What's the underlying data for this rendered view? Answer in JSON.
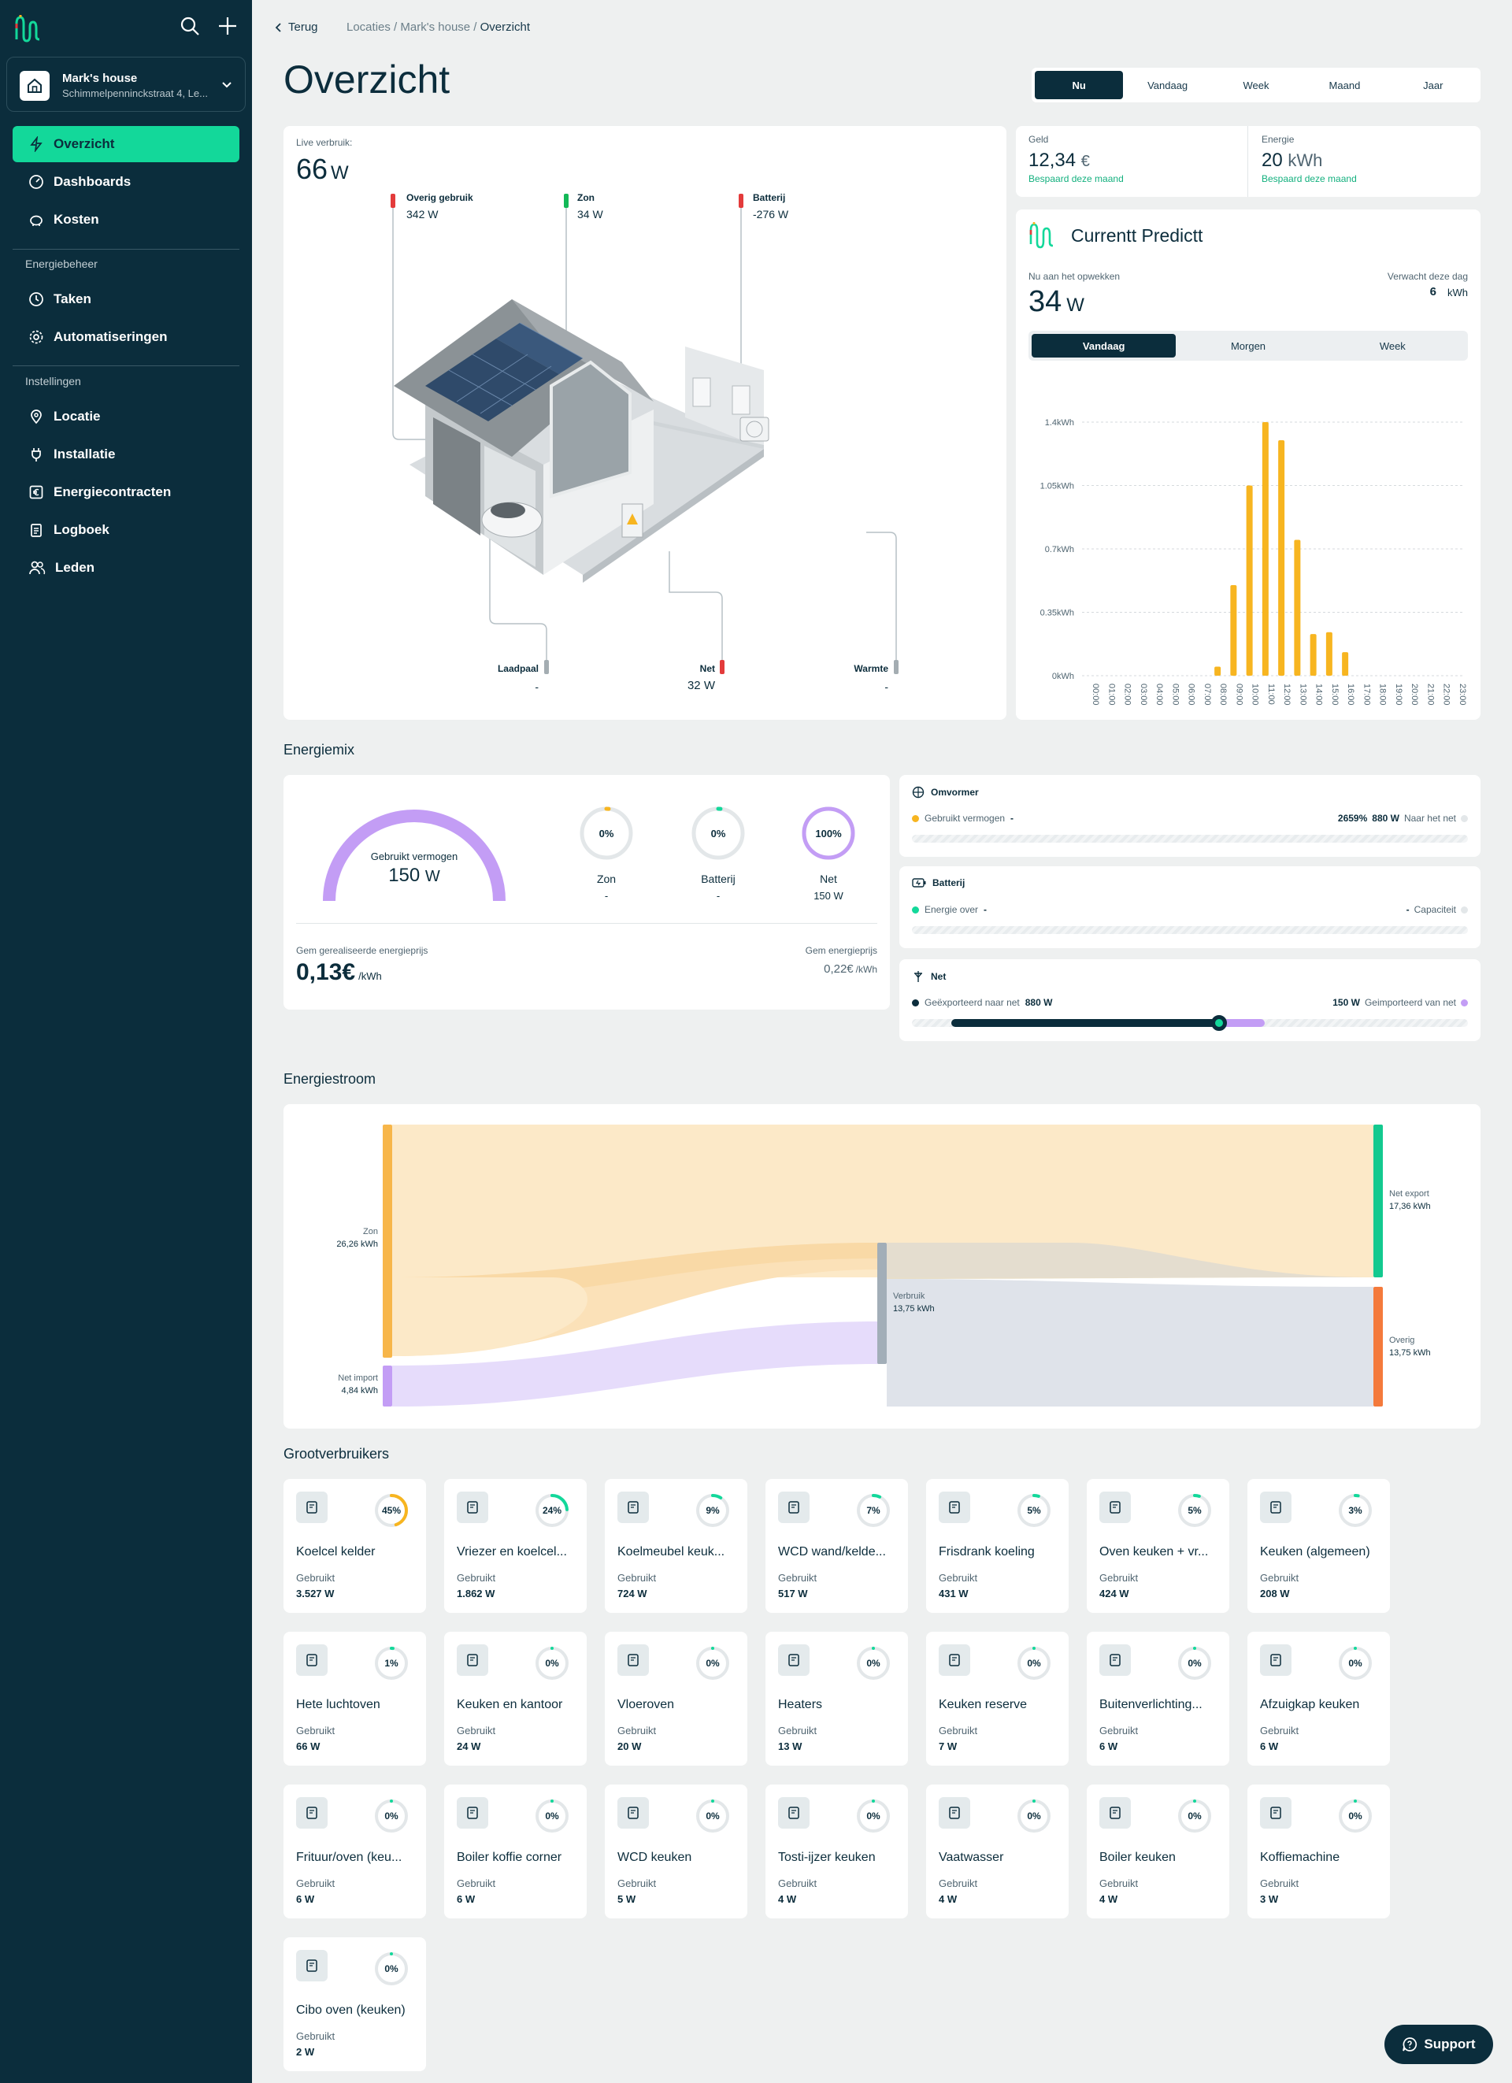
{
  "header": {
    "back": "Terug",
    "breadcrumb_a": "Locaties",
    "breadcrumb_b": "Mark's house",
    "breadcrumb_c": "Overzicht",
    "sep": "/",
    "title": "Overzicht",
    "time_tabs": [
      "Nu",
      "Vandaag",
      "Week",
      "Maand",
      "Jaar"
    ]
  },
  "sidebar": {
    "location_name": "Mark's house",
    "location_address": "Schimmelpenninckstraat 4, Le...",
    "nav_main": [
      "Overzicht",
      "Dashboards",
      "Kosten"
    ],
    "section_energy": "Energiebeheer",
    "nav_energy": [
      "Taken",
      "Automatiseringen"
    ],
    "section_settings": "Instellingen",
    "nav_settings": [
      "Locatie",
      "Installatie",
      "Energiecontracten",
      "Logboek",
      "Leden"
    ]
  },
  "live": {
    "label": "Live verbruik:",
    "value": "66",
    "unit": "W",
    "overig": {
      "label": "Overig gebruik",
      "value": "342 W"
    },
    "zon": {
      "label": "Zon",
      "value": "34 W"
    },
    "batterij": {
      "label": "Batterij",
      "value": "-276 W"
    },
    "laadpaal": {
      "label": "Laadpaal",
      "value": "-"
    },
    "net": {
      "label": "Net",
      "value": "32",
      "unit": "W"
    },
    "warmte": {
      "label": "Warmte",
      "value": "-"
    }
  },
  "summary": {
    "geld": {
      "label": "Geld",
      "value": "12,34",
      "unit": "€",
      "sub": "Bespaard deze maand"
    },
    "energie": {
      "label": "Energie",
      "value": "20",
      "unit": "kWh",
      "sub": "Bespaard deze maand"
    }
  },
  "predict": {
    "title": "Currentt Predictt",
    "now_label": "Nu aan het opwekken",
    "now_value": "34",
    "now_unit": "W",
    "exp_label": "Verwacht deze dag",
    "exp_value": "6",
    "exp_unit": "kWh",
    "tabs": [
      "Vandaag",
      "Morgen",
      "Week"
    ]
  },
  "chart_data": {
    "type": "bar",
    "categories": [
      "00:00",
      "01:00",
      "02:00",
      "03:00",
      "04:00",
      "05:00",
      "06:00",
      "07:00",
      "08:00",
      "09:00",
      "10:00",
      "11:00",
      "12:00",
      "13:00",
      "14:00",
      "15:00",
      "16:00",
      "17:00",
      "18:00",
      "19:00",
      "20:00",
      "21:00",
      "22:00",
      "23:00"
    ],
    "values": [
      0,
      0,
      0,
      0,
      0,
      0,
      0,
      0,
      0.05,
      0.5,
      1.05,
      1.4,
      1.3,
      0.75,
      0.23,
      0.24,
      0.13,
      0,
      0,
      0,
      0,
      0,
      0,
      0
    ],
    "yticks": [
      "0kWh",
      "0.35kWh",
      "0.7kWh",
      "1.05kWh",
      "1.4kWh"
    ],
    "ylim": [
      0,
      1.4
    ],
    "color": "#f7b520"
  },
  "energiemix": {
    "title": "Energiemix",
    "gauge_label": "Gebruikt vermogen",
    "gauge_value": "150",
    "gauge_unit": "W",
    "rings": [
      {
        "pct": "0%",
        "label": "Zon",
        "value": "-",
        "fraction": 0,
        "color": "#f7b520"
      },
      {
        "pct": "0%",
        "label": "Batterij",
        "value": "-",
        "fraction": 0,
        "color": "#13d89a"
      },
      {
        "pct": "100%",
        "label": "Net",
        "value": "150",
        "unit": "W",
        "fraction": 1,
        "color": "#c39df5"
      }
    ],
    "price_label": "Gem gerealiseerde energieprijs",
    "price_value": "0,13€",
    "price_unit": "/kWh",
    "avg_label": "Gem energieprijs",
    "avg_value": "0,22€",
    "avg_unit": "/kWh"
  },
  "omvormer": {
    "title": "Omvormer",
    "left_label": "Gebruikt vermogen",
    "left_value": "-",
    "right_pct": "2659%",
    "right_value": "880 W",
    "right_label": "Naar het net"
  },
  "batterij_card": {
    "title": "Batterij",
    "left_label": "Energie over",
    "left_value": "-",
    "right_value": "-",
    "right_label": "Capaciteit"
  },
  "net_card": {
    "title": "Net",
    "left_label": "Geëxporteerd naar net",
    "left_value": "880 W",
    "right_value": "150 W",
    "right_label": "Geimporteerd van net",
    "export_fraction": 0.854,
    "import_fraction": 0.146
  },
  "stroom": {
    "title": "Energiestroom",
    "zon_label": "Zon",
    "zon_value": "26,26 kWh",
    "import_label": "Net import",
    "import_value": "4,84 kWh",
    "verbruik_label": "Verbruik",
    "verbruik_value": "13,75 kWh",
    "export_label": "Net export",
    "export_value": "17,36 kWh",
    "overig_label": "Overig",
    "overig_value": "13,75 kWh"
  },
  "grootverbruikers": {
    "title": "Grootverbruikers",
    "used_label": "Gebruikt",
    "items": [
      {
        "name": "Koelcel kelder",
        "pct": "45%",
        "value": "3.527 W",
        "fraction": 0.45,
        "color": "#f7b520"
      },
      {
        "name": "Vriezer en koelcel...",
        "pct": "24%",
        "value": "1.862 W",
        "fraction": 0.24,
        "color": "#13d89a"
      },
      {
        "name": "Koelmeubel keuk...",
        "pct": "9%",
        "value": "724 W",
        "fraction": 0.09,
        "color": "#13d89a"
      },
      {
        "name": "WCD wand/kelde...",
        "pct": "7%",
        "value": "517 W",
        "fraction": 0.07,
        "color": "#13d89a"
      },
      {
        "name": "Frisdrank koeling",
        "pct": "5%",
        "value": "431 W",
        "fraction": 0.05,
        "color": "#13d89a"
      },
      {
        "name": "Oven keuken + vr...",
        "pct": "5%",
        "value": "424 W",
        "fraction": 0.05,
        "color": "#13d89a"
      },
      {
        "name": "Keuken (algemeen)",
        "pct": "3%",
        "value": "208 W",
        "fraction": 0.03,
        "color": "#13d89a"
      },
      {
        "name": "Hete luchtoven",
        "pct": "1%",
        "value": "66 W",
        "fraction": 0.01,
        "color": "#13d89a"
      },
      {
        "name": "Keuken en kantoor",
        "pct": "0%",
        "value": "24 W",
        "fraction": 0,
        "color": "#13d89a"
      },
      {
        "name": "Vloeroven",
        "pct": "0%",
        "value": "20 W",
        "fraction": 0,
        "color": "#13d89a"
      },
      {
        "name": "Heaters",
        "pct": "0%",
        "value": "13 W",
        "fraction": 0,
        "color": "#13d89a"
      },
      {
        "name": "Keuken reserve",
        "pct": "0%",
        "value": "7 W",
        "fraction": 0,
        "color": "#13d89a"
      },
      {
        "name": "Buitenverlichting...",
        "pct": "0%",
        "value": "6 W",
        "fraction": 0,
        "color": "#13d89a"
      },
      {
        "name": "Afzuigkap keuken",
        "pct": "0%",
        "value": "6 W",
        "fraction": 0,
        "color": "#13d89a"
      },
      {
        "name": "Frituur/oven (keu...",
        "pct": "0%",
        "value": "6 W",
        "fraction": 0,
        "color": "#13d89a"
      },
      {
        "name": "Boiler koffie corner",
        "pct": "0%",
        "value": "6 W",
        "fraction": 0,
        "color": "#13d89a"
      },
      {
        "name": "WCD keuken",
        "pct": "0%",
        "value": "5 W",
        "fraction": 0,
        "color": "#13d89a"
      },
      {
        "name": "Tosti-ijzer keuken",
        "pct": "0%",
        "value": "4 W",
        "fraction": 0,
        "color": "#13d89a"
      },
      {
        "name": "Vaatwasser",
        "pct": "0%",
        "value": "4 W",
        "fraction": 0,
        "color": "#13d89a"
      },
      {
        "name": "Boiler keuken",
        "pct": "0%",
        "value": "4 W",
        "fraction": 0,
        "color": "#13d89a"
      },
      {
        "name": "Koffiemachine",
        "pct": "0%",
        "value": "3 W",
        "fraction": 0,
        "color": "#13d89a"
      },
      {
        "name": "Cibo oven (keuken)",
        "pct": "0%",
        "value": "2 W",
        "fraction": 0,
        "color": "#13d89a"
      }
    ]
  },
  "support": "Support",
  "colors": {
    "brand": "#0b2d3c",
    "accent": "#13d89a",
    "sun": "#f7b520",
    "grid": "#c39df5",
    "red": "#e33b3b",
    "overig": "#f47a3c"
  }
}
